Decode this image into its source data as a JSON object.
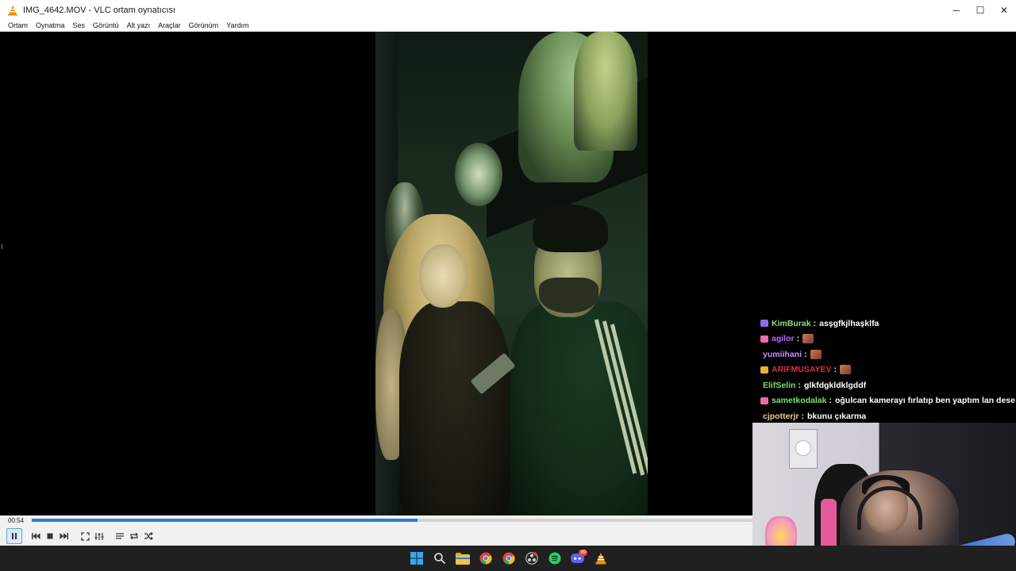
{
  "window": {
    "title": "IMG_4642.MOV - VLC ortam oynatıcısı",
    "controls": {
      "minimize": "─",
      "maximize": "☐",
      "close": "✕"
    }
  },
  "menu": [
    "Ortam",
    "Oynatma",
    "Ses",
    "Görüntü",
    "Alt yazı",
    "Araçlar",
    "Görünüm",
    "Yardım"
  ],
  "playback": {
    "elapsed": "00:54",
    "progress_fraction": 0.535,
    "accent_color": "#2b7cd3"
  },
  "chat": [
    {
      "badge": "heart-purple",
      "user": "KimBurak",
      "user_color": "#8fe07a",
      "sep": ":",
      "message": "asşgfkjlhaşklfa"
    },
    {
      "badge": "cat-pink",
      "user": "agilor",
      "user_color": "#b76cff",
      "sep": ":",
      "message": "",
      "emote": true
    },
    {
      "badge": "",
      "user": "yumiihani",
      "user_color": "#c98cff",
      "sep": ":",
      "message": "",
      "emote": true
    },
    {
      "badge": "crown-gold",
      "user": "ARIFMUSAYEV",
      "user_color": "#e0303a",
      "sep": ":",
      "message": "",
      "emote": true
    },
    {
      "badge": "",
      "user": "ElifSelin",
      "user_color": "#7fe06a",
      "sep": ":",
      "message": "glkfdgkldklgddf"
    },
    {
      "badge": "cat-pink",
      "user": "sametkodalak",
      "user_color": "#7fe06a",
      "sep": ":",
      "message": "oğulcan kamerayı fırlatıp ben yaptım lan dese"
    },
    {
      "badge": "",
      "user": "cjpotterjr",
      "user_color": "#f2c98a",
      "sep": ":",
      "message": "bkunu çıkarma"
    }
  ],
  "taskbar": {
    "icons": [
      "windows-start-icon",
      "search-icon",
      "file-explorer-icon",
      "chrome-icon",
      "chrome-alt-icon",
      "obs-icon",
      "spotify-icon",
      "discord-icon",
      "vlc-icon"
    ],
    "discord_badge": "99"
  }
}
